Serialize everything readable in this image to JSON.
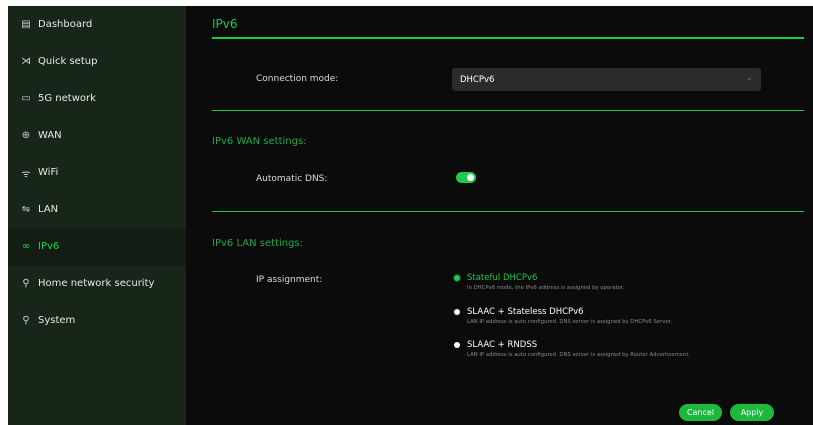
{
  "sidebar": {
    "items": [
      {
        "label": "Dashboard",
        "icon": "dashboard-icon",
        "glyph": "▤"
      },
      {
        "label": "Quick setup",
        "icon": "quick-setup-icon",
        "glyph": "⋊"
      },
      {
        "label": "5G network",
        "icon": "sim-card-icon",
        "glyph": "▭"
      },
      {
        "label": "WAN",
        "icon": "globe-icon",
        "glyph": "⊕"
      },
      {
        "label": "WiFi",
        "icon": "wifi-icon",
        "glyph": "ᯤ"
      },
      {
        "label": "LAN",
        "icon": "lan-icon",
        "glyph": "⇋"
      },
      {
        "label": "IPv6",
        "icon": "ipv6-icon",
        "glyph": "∞"
      },
      {
        "label": "Home network security",
        "icon": "security-icon",
        "glyph": "⚲"
      },
      {
        "label": "System",
        "icon": "system-icon",
        "glyph": "⚲"
      }
    ],
    "active_index": 6
  },
  "main": {
    "title": "IPv6",
    "connection_mode": {
      "label": "Connection mode:",
      "value": "DHCPv6"
    },
    "wan_section": "IPv6 WAN settings:",
    "automatic_dns": {
      "label": "Automatic DNS:",
      "enabled": true
    },
    "lan_section": "IPv6 LAN settings:",
    "ip_assignment": {
      "label": "IP assignment:",
      "options": [
        {
          "title": "Stateful DHCPv6",
          "desc": "In DHCPv6 mode, the IPv6 address is assigned by operator.",
          "selected": true
        },
        {
          "title": "SLAAC + Stateless DHCPv6",
          "desc": "LAN IP address is auto configured. DNS server is assigned by DHCPv6 Server.",
          "selected": false
        },
        {
          "title": "SLAAC + RNDSS",
          "desc": "LAN IP address is auto configured. DNS server is assigned by Router Advertisement.",
          "selected": false
        }
      ]
    },
    "buttons": {
      "cancel": "Cancel",
      "apply": "Apply"
    }
  },
  "colors": {
    "accent": "#1ec94a",
    "sidebar_bg": "#182619",
    "main_bg": "#0a0b0a"
  }
}
